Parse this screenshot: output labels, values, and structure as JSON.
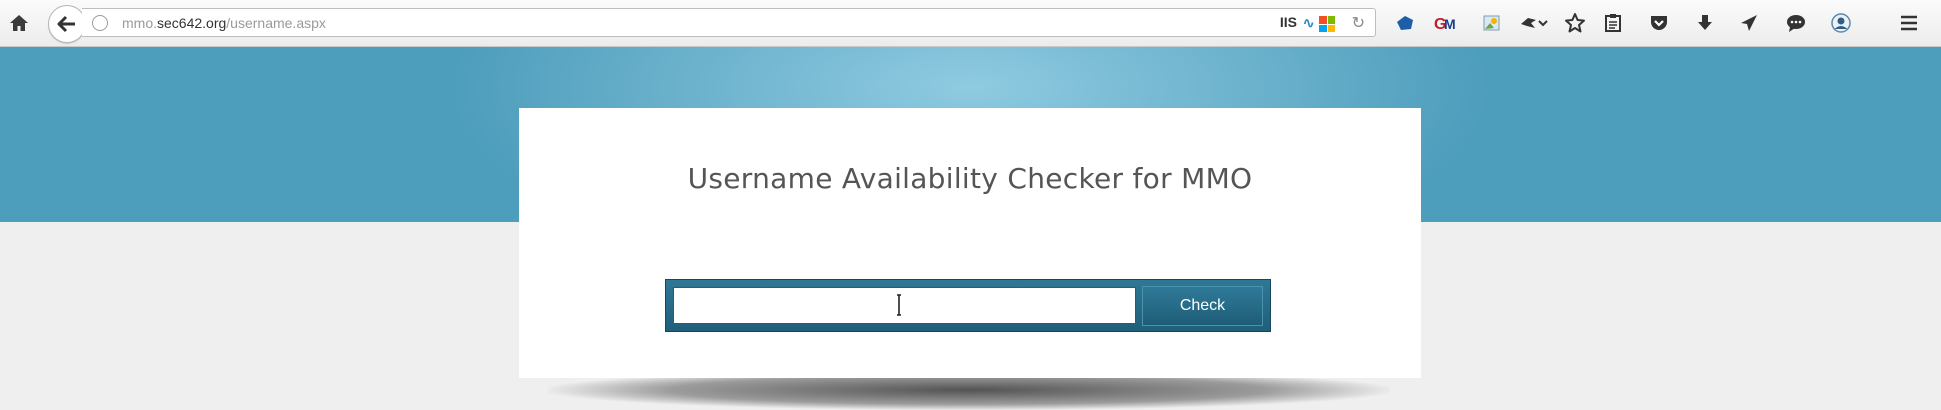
{
  "browser": {
    "url": {
      "prefix": "mmo.",
      "domain": "sec642.org",
      "path": "/username.aspx"
    },
    "server_badge": "IIS",
    "icons": [
      "home-icon",
      "back-arrow-icon",
      "globe-icon",
      "iis-wave-icon",
      "windows-logo-icon",
      "reload-icon",
      "extension-blue-icon",
      "gmail-extension-icon",
      "photo-extension-icon",
      "ninja-extension-icon",
      "chevron-down-icon",
      "bookmark-star-icon",
      "reader-view-icon",
      "pocket-icon",
      "download-icon",
      "send-icon",
      "chat-icon",
      "profile-icon",
      "hamburger-menu-icon"
    ]
  },
  "page": {
    "title": "Username Availability Checker for MMO",
    "form": {
      "username_value": "",
      "check_label": "Check"
    }
  },
  "colors": {
    "banner": "#5aa8c6",
    "form_bg": "#27708c",
    "page_bg": "#efefef"
  }
}
